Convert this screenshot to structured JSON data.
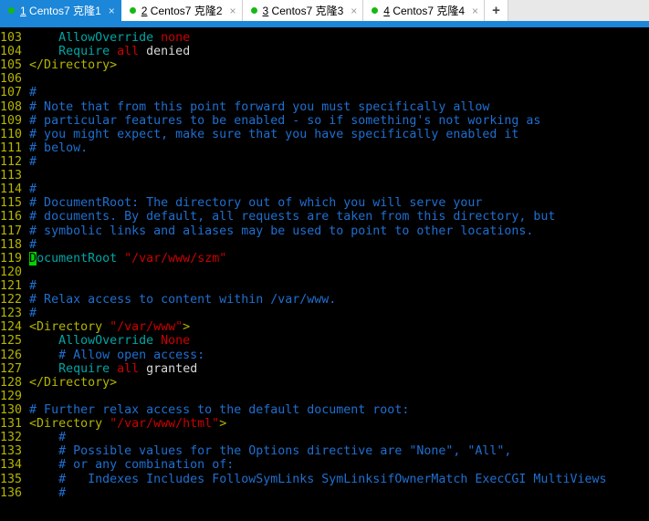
{
  "tabbar": {
    "new_tab_label": "+",
    "close_glyph": "×",
    "dot_color": "#16b816",
    "active_bg": "#1c86d8",
    "tabs": [
      {
        "index": "1",
        "name": "Centos7 克隆",
        "suffix": "1",
        "active": true
      },
      {
        "index": "2",
        "name": "Centos7 克隆",
        "suffix": "2",
        "active": false
      },
      {
        "index": "3",
        "name": "Centos7 克隆",
        "suffix": "3",
        "active": false
      },
      {
        "index": "4",
        "name": "Centos7 克隆",
        "suffix": "4",
        "active": false
      }
    ]
  },
  "terminal": {
    "background": "#000000",
    "cursor_color": "#00d400",
    "cursor_line": "119",
    "cursor_char": "D",
    "colors": {
      "line_number": "#b5b500",
      "comment": "#1f6fd0",
      "tag": "#b5b500",
      "string": "#cc0000",
      "directive": "#00a5a5",
      "keyword": "#cc0000",
      "plain": "#d8d8d8"
    },
    "lines": [
      {
        "n": "103",
        "segs": [
          {
            "t": "    ",
            "c": "plain"
          },
          {
            "t": "AllowOverride ",
            "c": "dir"
          },
          {
            "t": "none",
            "c": "kw"
          }
        ]
      },
      {
        "n": "104",
        "segs": [
          {
            "t": "    ",
            "c": "plain"
          },
          {
            "t": "Require ",
            "c": "dir"
          },
          {
            "t": "all",
            "c": "kw"
          },
          {
            "t": " denied",
            "c": "plain"
          }
        ]
      },
      {
        "n": "105",
        "segs": [
          {
            "t": "</Directory>",
            "c": "tag"
          }
        ]
      },
      {
        "n": "106",
        "segs": []
      },
      {
        "n": "107",
        "segs": [
          {
            "t": "#",
            "c": "cmt"
          }
        ]
      },
      {
        "n": "108",
        "segs": [
          {
            "t": "# Note that from this point forward you must specifically allow",
            "c": "cmt"
          }
        ]
      },
      {
        "n": "109",
        "segs": [
          {
            "t": "# particular features to be enabled - so if something's not working as",
            "c": "cmt"
          }
        ]
      },
      {
        "n": "110",
        "segs": [
          {
            "t": "# you might expect, make sure that you have specifically enabled it",
            "c": "cmt"
          }
        ]
      },
      {
        "n": "111",
        "segs": [
          {
            "t": "# below.",
            "c": "cmt"
          }
        ]
      },
      {
        "n": "112",
        "segs": [
          {
            "t": "#",
            "c": "cmt"
          }
        ]
      },
      {
        "n": "113",
        "segs": []
      },
      {
        "n": "114",
        "segs": [
          {
            "t": "#",
            "c": "cmt"
          }
        ]
      },
      {
        "n": "115",
        "segs": [
          {
            "t": "# DocumentRoot: The directory out of which you will serve your",
            "c": "cmt"
          }
        ]
      },
      {
        "n": "116",
        "segs": [
          {
            "t": "# documents. By default, all requests are taken from this directory, but",
            "c": "cmt"
          }
        ]
      },
      {
        "n": "117",
        "segs": [
          {
            "t": "# symbolic links and aliases may be used to point to other locations.",
            "c": "cmt"
          }
        ]
      },
      {
        "n": "118",
        "segs": [
          {
            "t": "#",
            "c": "cmt"
          }
        ]
      },
      {
        "n": "119",
        "segs": [
          {
            "t": "D",
            "c": "cursor"
          },
          {
            "t": "ocumentRoot ",
            "c": "dir"
          },
          {
            "t": "\"/var/www/szm\"",
            "c": "str"
          }
        ]
      },
      {
        "n": "120",
        "segs": []
      },
      {
        "n": "121",
        "segs": [
          {
            "t": "#",
            "c": "cmt"
          }
        ]
      },
      {
        "n": "122",
        "segs": [
          {
            "t": "# Relax access to content within /var/www.",
            "c": "cmt"
          }
        ]
      },
      {
        "n": "123",
        "segs": [
          {
            "t": "#",
            "c": "cmt"
          }
        ]
      },
      {
        "n": "124",
        "segs": [
          {
            "t": "<Directory ",
            "c": "tag"
          },
          {
            "t": "\"/var/www\"",
            "c": "str"
          },
          {
            "t": ">",
            "c": "tag"
          }
        ]
      },
      {
        "n": "125",
        "segs": [
          {
            "t": "    ",
            "c": "plain"
          },
          {
            "t": "AllowOverride ",
            "c": "dir"
          },
          {
            "t": "None",
            "c": "kw"
          }
        ]
      },
      {
        "n": "126",
        "segs": [
          {
            "t": "    ",
            "c": "plain"
          },
          {
            "t": "# Allow open access:",
            "c": "cmt"
          }
        ]
      },
      {
        "n": "127",
        "segs": [
          {
            "t": "    ",
            "c": "plain"
          },
          {
            "t": "Require ",
            "c": "dir"
          },
          {
            "t": "all",
            "c": "kw"
          },
          {
            "t": " granted",
            "c": "plain"
          }
        ]
      },
      {
        "n": "128",
        "segs": [
          {
            "t": "</Directory>",
            "c": "tag"
          }
        ]
      },
      {
        "n": "129",
        "segs": []
      },
      {
        "n": "130",
        "segs": [
          {
            "t": "# Further relax access to the default document root:",
            "c": "cmt"
          }
        ]
      },
      {
        "n": "131",
        "segs": [
          {
            "t": "<Directory ",
            "c": "tag"
          },
          {
            "t": "\"/var/www/html\"",
            "c": "str"
          },
          {
            "t": ">",
            "c": "tag"
          }
        ]
      },
      {
        "n": "132",
        "segs": [
          {
            "t": "    ",
            "c": "plain"
          },
          {
            "t": "#",
            "c": "cmt"
          }
        ]
      },
      {
        "n": "133",
        "segs": [
          {
            "t": "    ",
            "c": "plain"
          },
          {
            "t": "# Possible values for the Options directive are \"None\", \"All\",",
            "c": "cmt"
          }
        ]
      },
      {
        "n": "134",
        "segs": [
          {
            "t": "    ",
            "c": "plain"
          },
          {
            "t": "# or any combination of:",
            "c": "cmt"
          }
        ]
      },
      {
        "n": "135",
        "segs": [
          {
            "t": "    ",
            "c": "plain"
          },
          {
            "t": "#   Indexes Includes FollowSymLinks SymLinksifOwnerMatch ExecCGI MultiViews",
            "c": "cmt"
          }
        ]
      },
      {
        "n": "136",
        "segs": [
          {
            "t": "    ",
            "c": "plain"
          },
          {
            "t": "#",
            "c": "cmt"
          }
        ]
      }
    ]
  }
}
